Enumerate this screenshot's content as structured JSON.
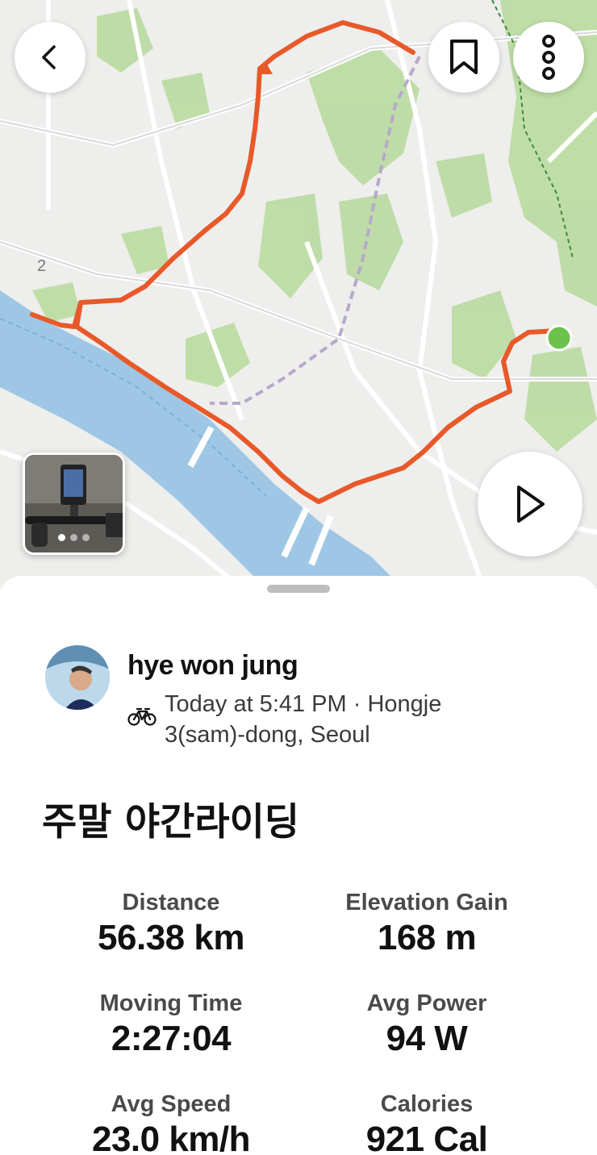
{
  "map": {
    "route_color": "#e8592a",
    "start_marker_color": "#6cc24a",
    "road_label": "2"
  },
  "header": {
    "back_icon": "chevron-left-icon",
    "bookmark_icon": "bookmark-icon",
    "more_icon": "more-vertical-icon"
  },
  "photo": {
    "count": 3,
    "selected_index": 0
  },
  "play_icon": "play-icon",
  "activity": {
    "user_name": "hye won jung",
    "sport_icon": "bicycle-icon",
    "meta_line1": "Today at 5:41 PM · Hongje",
    "meta_line2": "3(sam)-dong, Seoul",
    "title": "주말 야간라이딩"
  },
  "stats": {
    "distance_label": "Distance",
    "distance_value": "56.38 km",
    "elevation_label": "Elevation Gain",
    "elevation_value": "168 m",
    "moving_time_label": "Moving Time",
    "moving_time_value": "2:27:04",
    "avg_power_label": "Avg Power",
    "avg_power_value": "94 W",
    "avg_speed_label": "Avg Speed",
    "avg_speed_value": "23.0 km/h",
    "calories_label": "Calories",
    "calories_value": "921 Cal"
  }
}
